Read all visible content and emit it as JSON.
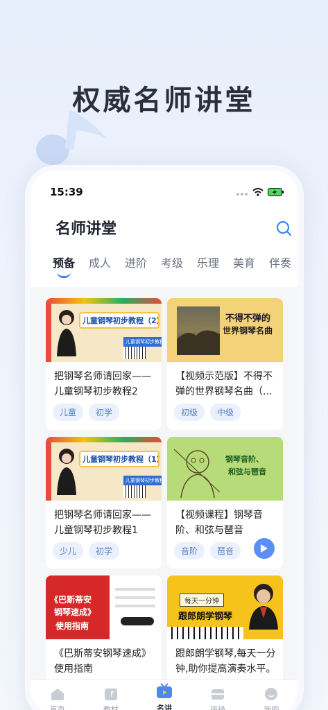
{
  "headline": "权威名师讲堂",
  "status": {
    "time": "15:39"
  },
  "page": {
    "title": "名师讲堂"
  },
  "tabs": [
    "预备",
    "成人",
    "进阶",
    "考级",
    "乐理",
    "美育",
    "伴奏"
  ],
  "cards": [
    {
      "title": "把钢琴名师请回家——儿童钢琴初步教程2",
      "tags": [
        "儿童",
        "初学"
      ],
      "thumb": {
        "main": "儿童钢琴初步教程（2）",
        "sub": "儿童钢琴初步教程"
      }
    },
    {
      "title": "【视频示范版】不得不弹的世界钢琴名曲（...",
      "tags": [
        "初级",
        "中级"
      ],
      "thumb": {
        "main": "不得不弹的",
        "sub": "世界钢琴名曲"
      }
    },
    {
      "title": "把钢琴名师请回家——儿童钢琴初步教程1",
      "tags": [
        "少儿",
        "初学"
      ],
      "thumb": {
        "main": "儿童钢琴初步教程（1）",
        "sub": "儿童钢琴初步教程"
      }
    },
    {
      "title": "【视频课程】钢琴音阶、和弦与琶音",
      "tags": [
        "音阶",
        "琶音"
      ],
      "thumb": {
        "main": "钢琴音阶、",
        "sub": "和弦与琶音"
      }
    },
    {
      "title": "《巴斯蒂安钢琴速成》使用指南",
      "tags": [],
      "thumb": {
        "main": "《巴斯蒂安",
        "sub": "钢琴速成》",
        "sub2": "使用指南"
      }
    },
    {
      "title": "跟郎朗学钢琴,每天一分钟,助你提高演奏水平。",
      "tags": [],
      "thumb": {
        "main": "每天一分钟",
        "sub": "跟郎朗学钢琴"
      }
    }
  ],
  "tabbar": [
    "首页",
    "教材",
    "名讲",
    "班级",
    "我的"
  ],
  "colors": {
    "accent": "#3b82f6",
    "tag_bg": "#eaf1fd",
    "tag_text": "#5b7fbf"
  }
}
